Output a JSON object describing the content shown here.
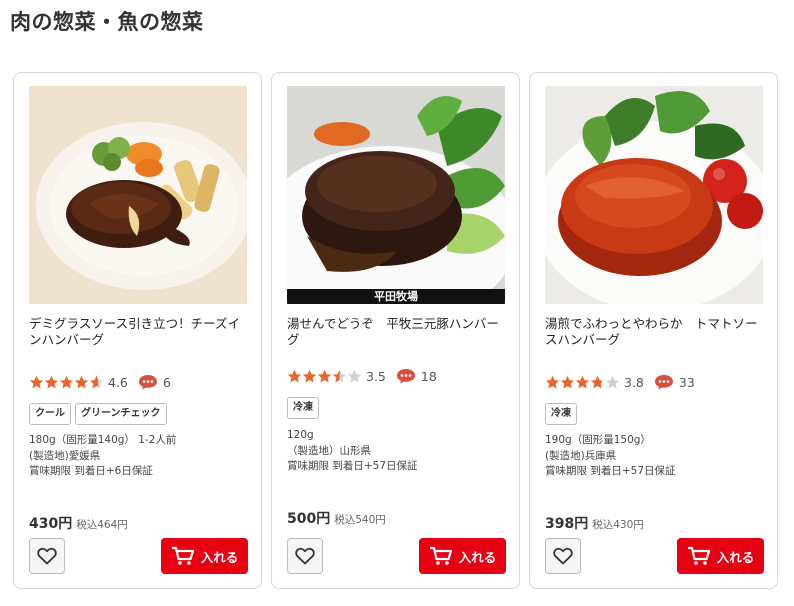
{
  "page": {
    "title": "肉の惣菜・魚の惣菜"
  },
  "colors": {
    "accent": "#e60012",
    "star": "#e8662b",
    "comment": "#d9503f"
  },
  "products": [
    {
      "name": "デミグラスソース引き立つ！チーズインハンバーグ",
      "rating": 4.6,
      "rating_text": "4.6",
      "comments": "6",
      "tags": [
        "クール",
        "グリーンチェック"
      ],
      "spec": [
        "180g（固形量140g） 1-2人前",
        "(製造地)愛媛県",
        "賞味期限 到着日+6日保証"
      ],
      "price": "430円",
      "tax_price": "税込464円",
      "farm_label": "",
      "cart_label": "入れる"
    },
    {
      "name": "湯せんでどうぞ　平牧三元豚ハンバーグ",
      "rating": 3.5,
      "rating_text": "3.5",
      "comments": "18",
      "tags": [
        "冷凍"
      ],
      "spec": [
        "120g",
        "（製造地）山形県",
        "賞味期限 到着日+57日保証"
      ],
      "price": "500円",
      "tax_price": "税込540円",
      "farm_label": "平田牧場",
      "cart_label": "入れる"
    },
    {
      "name": "湯煎でふわっとやわらか　トマトソースハンバーグ",
      "rating": 3.8,
      "rating_text": "3.8",
      "comments": "33",
      "tags": [
        "冷凍"
      ],
      "spec": [
        "190g（固形量150g）",
        "(製造地)兵庫県",
        "賞味期限 到着日+57日保証"
      ],
      "price": "398円",
      "tax_price": "税込430円",
      "farm_label": "",
      "cart_label": "入れる"
    }
  ]
}
